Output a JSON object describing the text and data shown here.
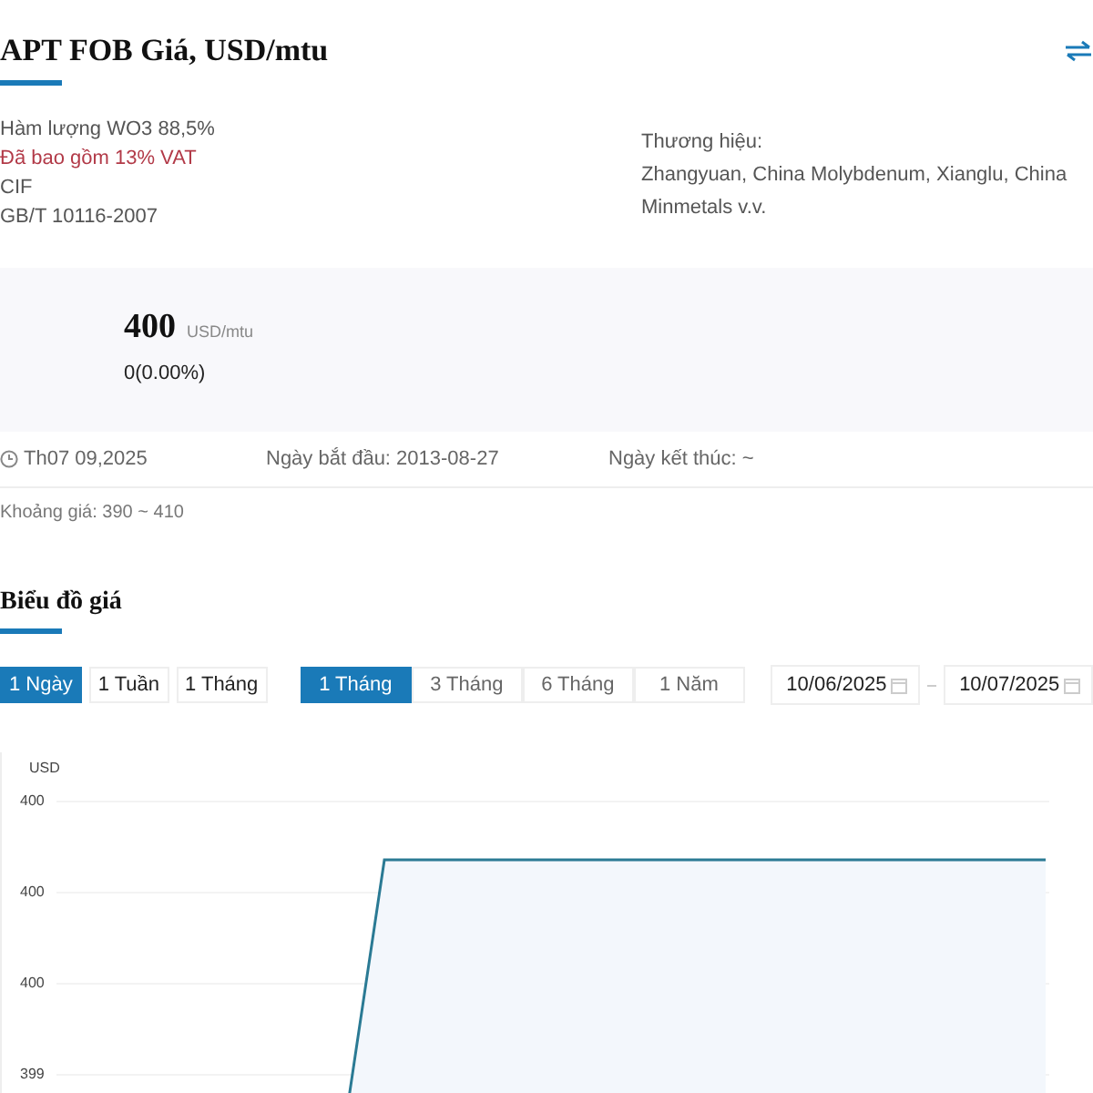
{
  "header": {
    "title": "APT FOB Giá, USD/mtu"
  },
  "specs": [
    {
      "text": "Hàm lượng WO3 88,5%",
      "kind": "plain"
    },
    {
      "text": "Đã bao gồm 13% VAT",
      "kind": "note"
    },
    {
      "text": "CIF",
      "kind": "plain"
    },
    {
      "text": "GB/T 10116-2007",
      "kind": "plain"
    }
  ],
  "brand": {
    "label": "Thương hiệu:",
    "value": "Zhangyuan, China Molybdenum, Xianglu, China Minmetals v.v."
  },
  "price": {
    "value": "400",
    "unit": "USD/mtu",
    "change": "0(0.00%)"
  },
  "dates": {
    "updated": "Th07 09,2025",
    "start": "Ngày bắt đầu: 2013-08-27",
    "end": "Ngày kết thúc: ~"
  },
  "range": {
    "label": "Khoảng giá:",
    "value": "390 ~ 410"
  },
  "chart_section": {
    "title": "Biểu đồ giá",
    "intervals": [
      {
        "label": "1 Ngày",
        "selected": true
      },
      {
        "label": "1 Tuần",
        "selected": false
      },
      {
        "label": "1 Tháng",
        "selected": false
      }
    ],
    "periods": [
      {
        "label": "1 Tháng",
        "selected": true
      },
      {
        "label": "3 Tháng",
        "selected": false
      },
      {
        "label": "6 Tháng",
        "selected": false
      },
      {
        "label": "1 Năm",
        "selected": false
      }
    ],
    "date_from": "10/06/2025",
    "date_to": "10/07/2025",
    "unit": "USD",
    "y_tick_labels": [
      "400",
      "400",
      "400",
      "399"
    ]
  }
}
